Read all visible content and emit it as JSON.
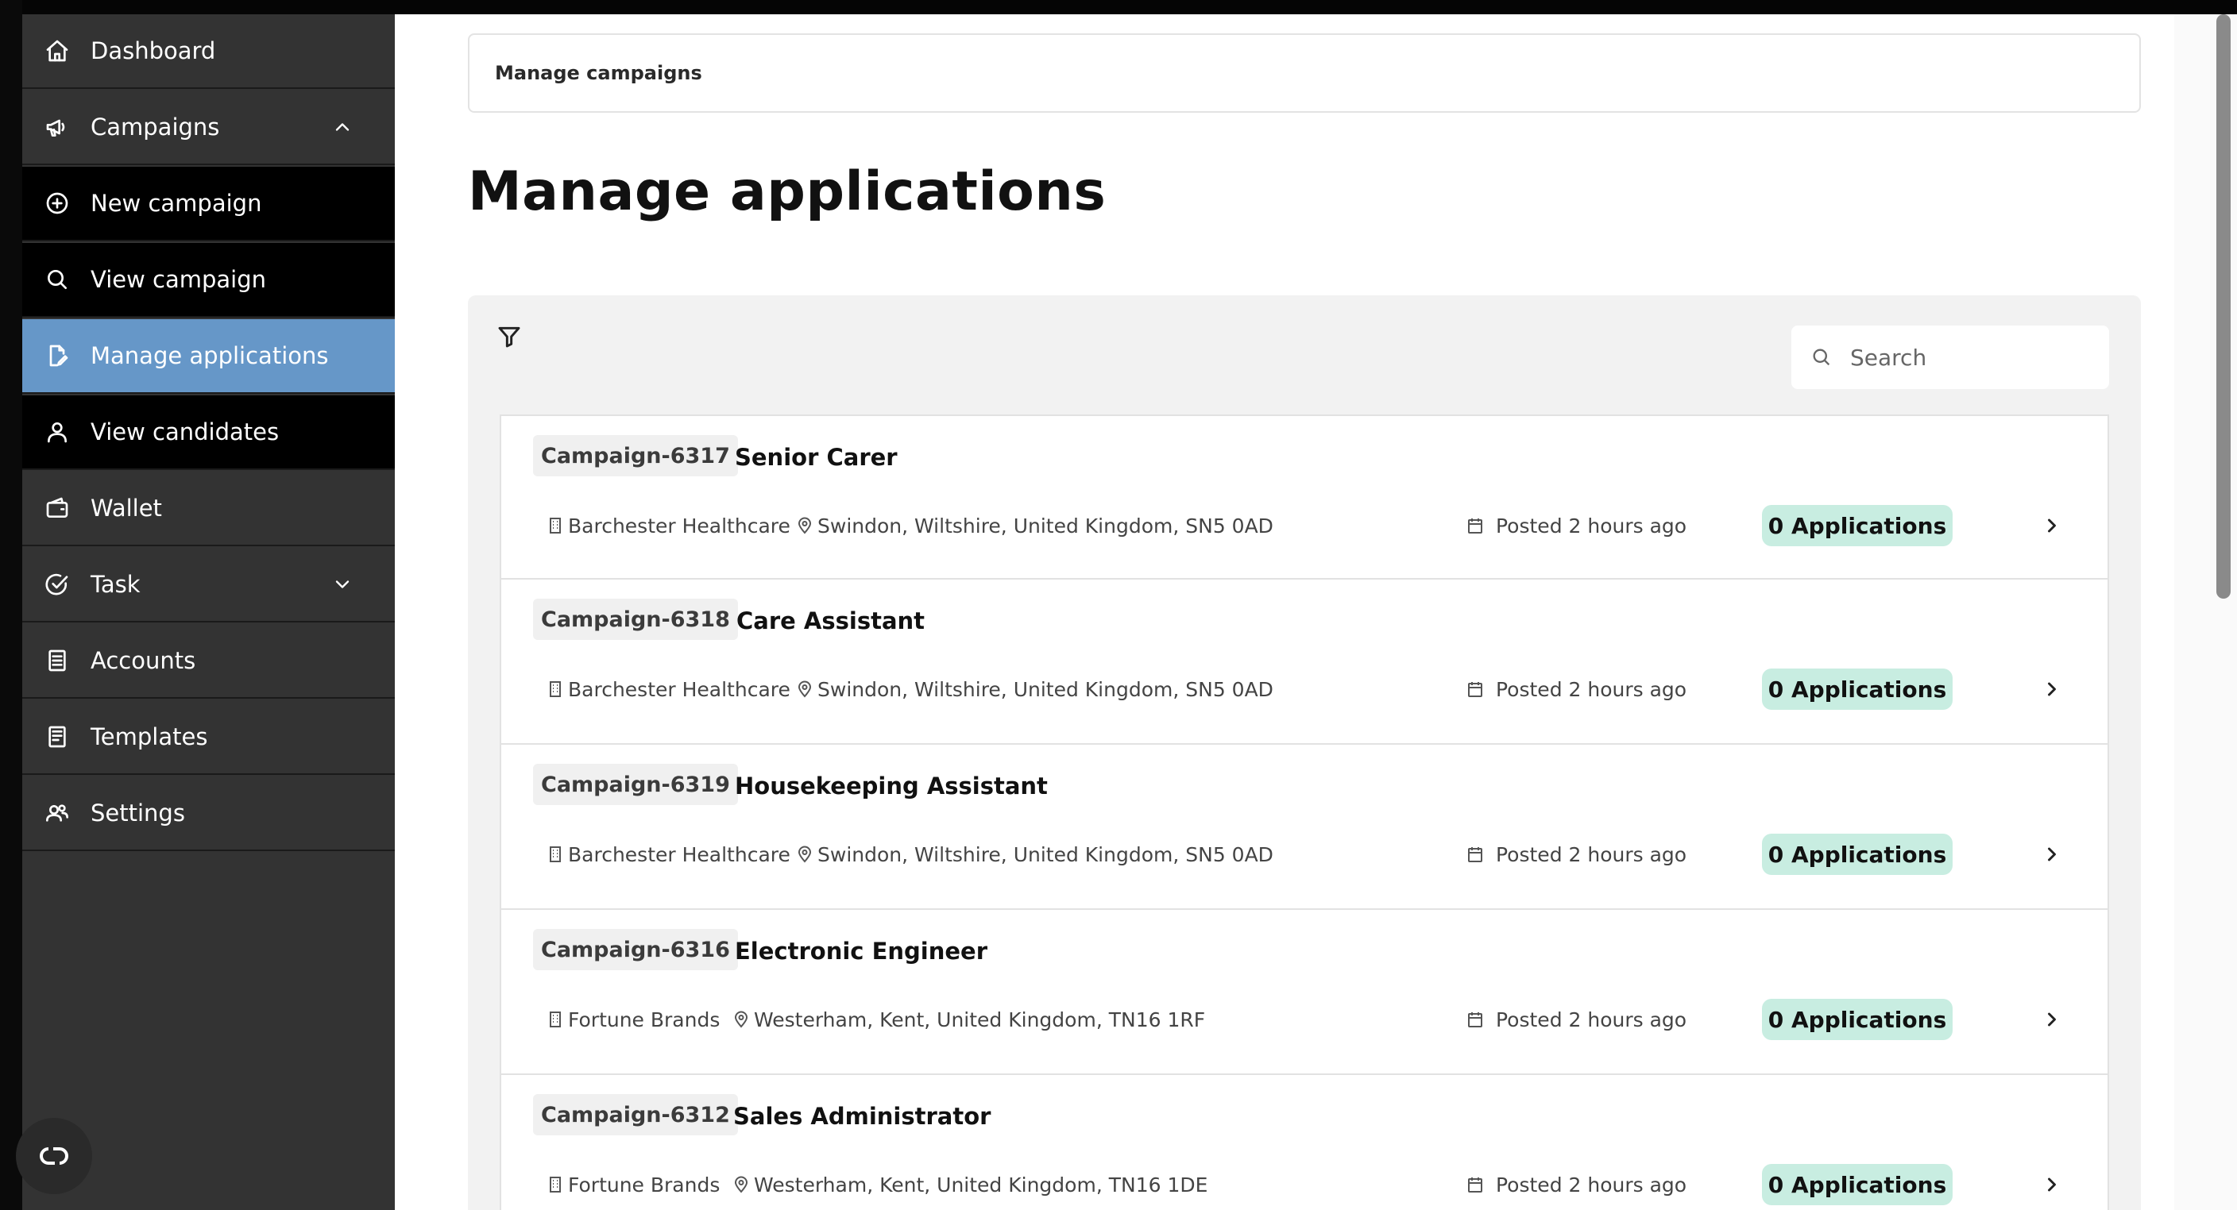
{
  "sidebar": {
    "items": [
      {
        "label": "Dashboard",
        "icon": "home-icon"
      },
      {
        "label": "Campaigns",
        "icon": "megaphone-icon",
        "expanded": true
      },
      {
        "label": "New campaign",
        "icon": "plus-circle-icon"
      },
      {
        "label": "View campaign",
        "icon": "search-icon"
      },
      {
        "label": "Manage applications",
        "icon": "edit-document-icon",
        "active": true
      },
      {
        "label": "View candidates",
        "icon": "user-icon"
      },
      {
        "label": "Wallet",
        "icon": "wallet-icon"
      },
      {
        "label": "Task",
        "icon": "check-circle-icon",
        "expanded": false
      },
      {
        "label": "Accounts",
        "icon": "document-list-icon"
      },
      {
        "label": "Templates",
        "icon": "template-icon"
      },
      {
        "label": "Settings",
        "icon": "users-settings-icon"
      }
    ]
  },
  "breadcrumb": {
    "label": "Manage campaigns"
  },
  "page": {
    "title": "Manage applications"
  },
  "search": {
    "placeholder": "Search"
  },
  "colors": {
    "sidebar_bg": "#333333",
    "active_bg": "#6697c8",
    "badge_bg": "#c8ede1"
  },
  "campaigns": [
    {
      "id": "Campaign-6317",
      "title": "Senior Carer",
      "company": "Barchester Healthcare",
      "location": "Swindon, Wiltshire, United Kingdom, SN5 0AD",
      "posted": "Posted 2 hours ago",
      "applications": "0 Applications"
    },
    {
      "id": "Campaign-6318",
      "title": "Care Assistant",
      "company": "Barchester Healthcare",
      "location": "Swindon, Wiltshire, United Kingdom, SN5 0AD",
      "posted": "Posted 2 hours ago",
      "applications": "0 Applications"
    },
    {
      "id": "Campaign-6319",
      "title": "Housekeeping Assistant",
      "company": "Barchester Healthcare",
      "location": "Swindon, Wiltshire, United Kingdom, SN5 0AD",
      "posted": "Posted 2 hours ago",
      "applications": "0 Applications"
    },
    {
      "id": "Campaign-6316",
      "title": "Electronic Engineer",
      "company": "Fortune Brands",
      "location": "Westerham, Kent, United Kingdom, TN16 1RF",
      "posted": "Posted 2 hours ago",
      "applications": "0 Applications"
    },
    {
      "id": "Campaign-6312",
      "title": "Sales Administrator",
      "company": "Fortune Brands",
      "location": "Westerham, Kent, United Kingdom, TN16 1DE",
      "posted": "Posted 2 hours ago",
      "applications": "0 Applications"
    }
  ]
}
